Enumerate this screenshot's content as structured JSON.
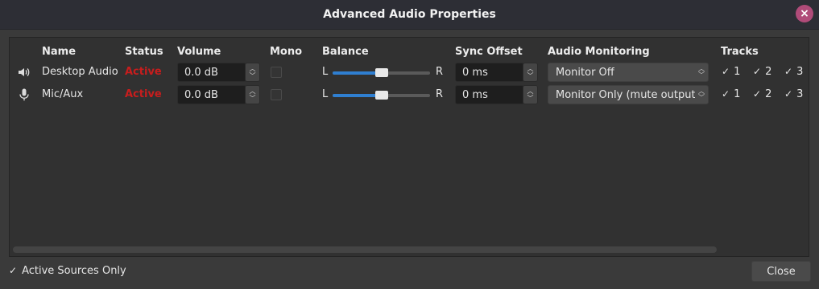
{
  "window": {
    "title": "Advanced Audio Properties",
    "close_icon": "×"
  },
  "headers": {
    "name": "Name",
    "status": "Status",
    "volume": "Volume",
    "mono": "Mono",
    "balance": "Balance",
    "sync_offset": "Sync Offset",
    "audio_monitoring": "Audio Monitoring",
    "tracks": "Tracks"
  },
  "sources": [
    {
      "icon": "speaker-icon",
      "name": "Desktop Audio",
      "status": "Active",
      "volume": "0.0 dB",
      "mono": false,
      "balance_left": "L",
      "balance_right": "R",
      "balance_value": 0.5,
      "sync_offset": "0 ms",
      "monitoring": "Monitor Off",
      "tracks": [
        "1",
        "2",
        "3"
      ],
      "tracks_checked": [
        true,
        true,
        true
      ]
    },
    {
      "icon": "microphone-icon",
      "name": "Mic/Aux",
      "status": "Active",
      "volume": "0.0 dB",
      "mono": false,
      "balance_left": "L",
      "balance_right": "R",
      "balance_value": 0.5,
      "sync_offset": "0 ms",
      "monitoring": "Monitor Only (mute output)",
      "tracks": [
        "1",
        "2",
        "3"
      ],
      "tracks_checked": [
        true,
        true,
        true
      ]
    }
  ],
  "footer": {
    "active_only_label": "Active Sources Only",
    "active_only_checked": true,
    "close_label": "Close"
  },
  "colors": {
    "status_active": "#c81d1d",
    "slider_fill": "#2f7fd1",
    "close_badge": "#b04b79"
  }
}
